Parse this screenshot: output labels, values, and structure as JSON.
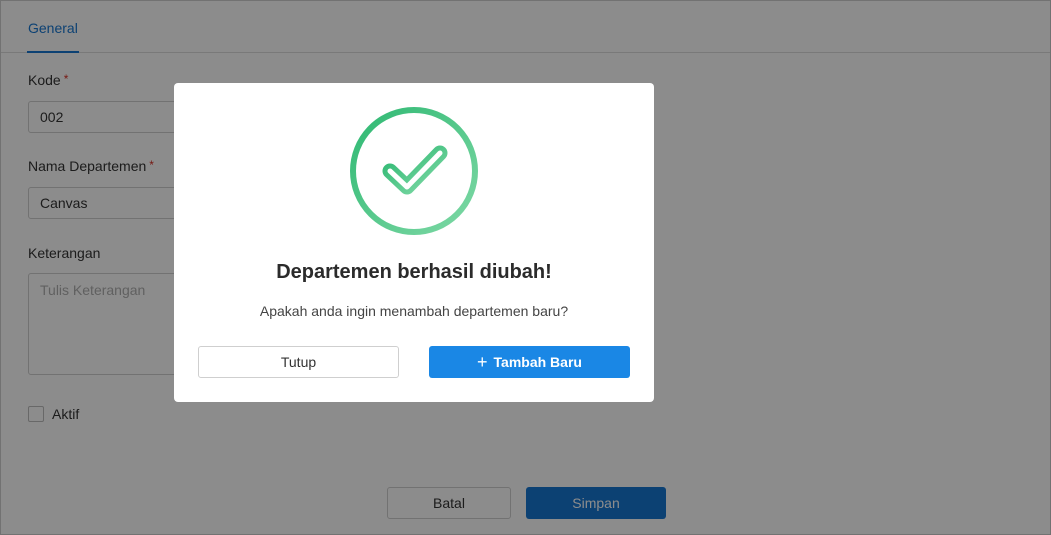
{
  "tabs": [
    {
      "label": "General",
      "active": true
    }
  ],
  "form": {
    "kode": {
      "label": "Kode",
      "required_mark": "*",
      "value": "002"
    },
    "nama": {
      "label": "Nama Departemen",
      "required_mark": "*",
      "value": "Canvas"
    },
    "keterangan": {
      "label": "Keterangan",
      "placeholder": "Tulis Keterangan",
      "value": ""
    },
    "aktif": {
      "label": "Aktif",
      "checked": false
    }
  },
  "footer": {
    "cancel_label": "Batal",
    "save_label": "Simpan"
  },
  "modal": {
    "icon": "success-check-icon",
    "title": "Departemen berhasil diubah!",
    "message": "Apakah anda ingin menambah departemen baru?",
    "close_label": "Tutup",
    "add_icon": "plus-icon",
    "add_label": "Tambah Baru"
  },
  "colors": {
    "primary": "#1677d2",
    "modal_primary": "#1a87e5",
    "success_start": "#2eb872",
    "success_end": "#7fd9a6",
    "required": "#d93025"
  }
}
